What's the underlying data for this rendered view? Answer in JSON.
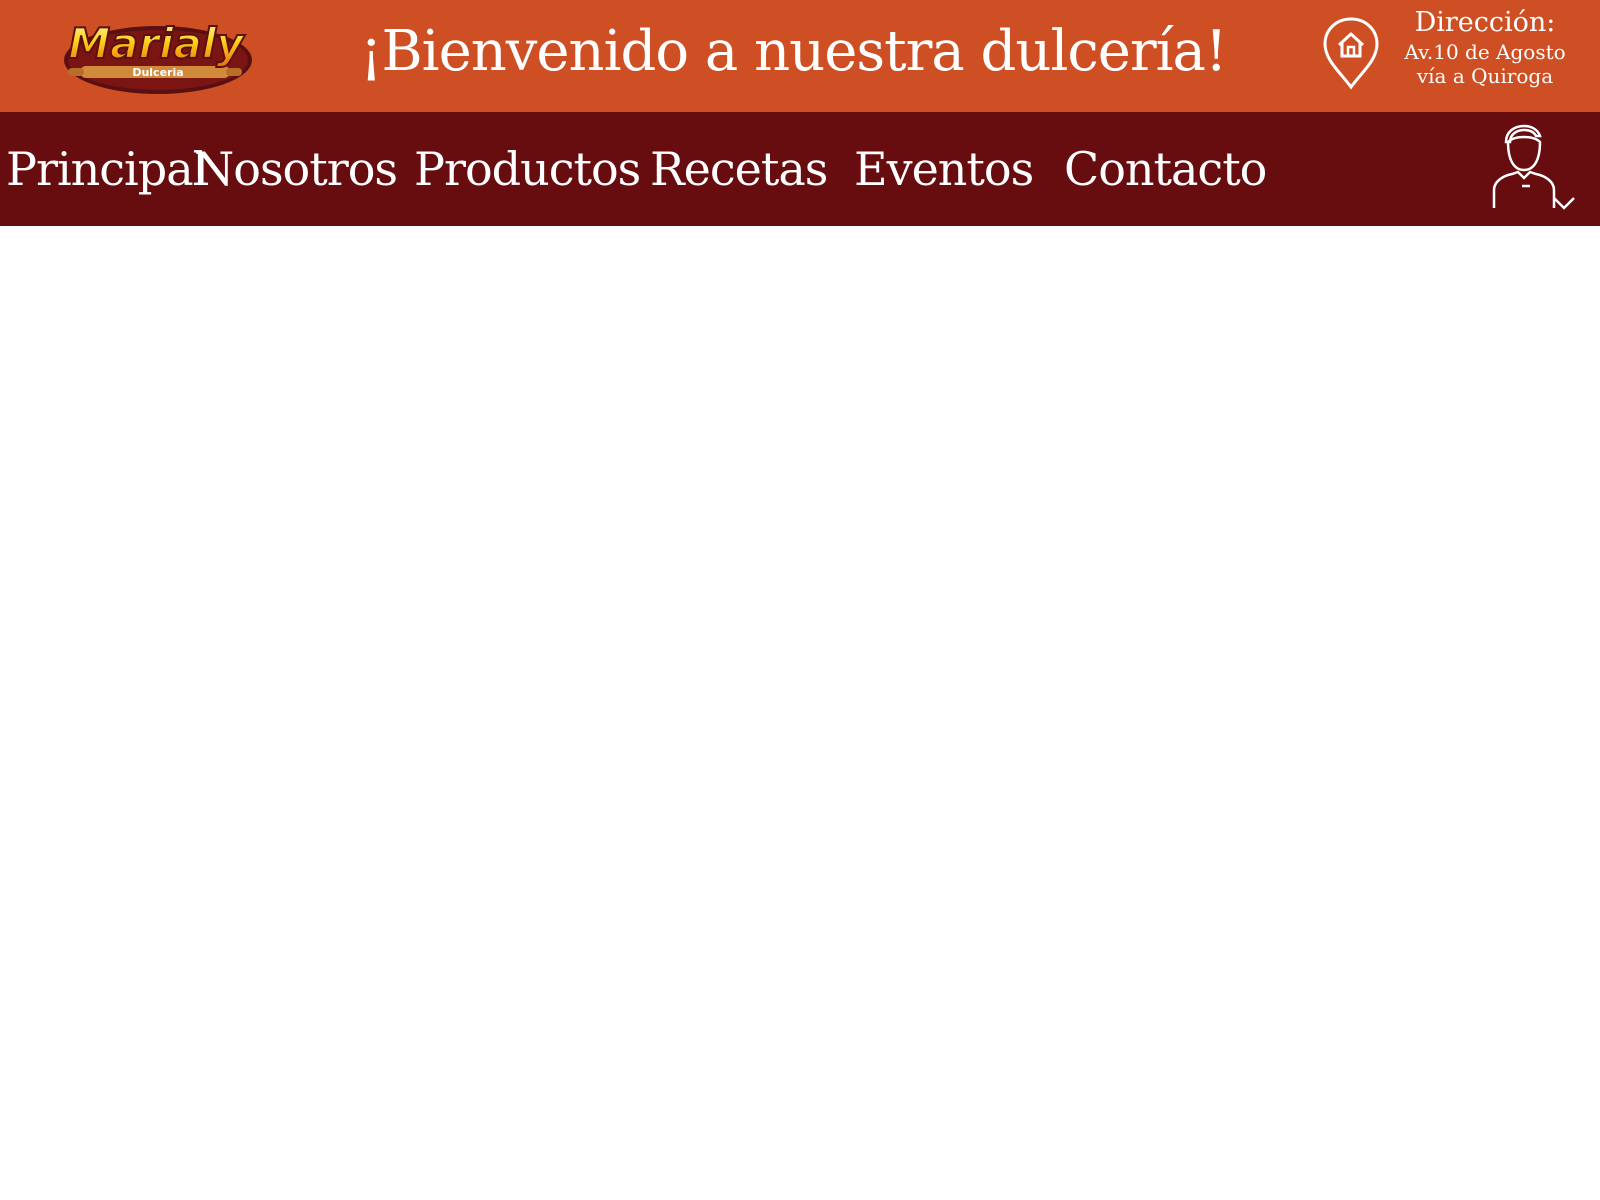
{
  "header": {
    "logo": {
      "brand_name": "Marialy",
      "tagline": "Dulceria"
    },
    "welcome_title": "¡Bienvenido a nuestra dulcería!",
    "address": {
      "title": "Dirección:",
      "line1": "Av.10 de Agosto",
      "line2": "vía a Quiroga",
      "icon": "home-location-pin-icon"
    }
  },
  "nav": {
    "items": [
      {
        "label": "Principal"
      },
      {
        "label": "Nosotros"
      },
      {
        "label": "Productos"
      },
      {
        "label": "Recetas"
      },
      {
        "label": "Eventos"
      },
      {
        "label": "Contacto"
      }
    ],
    "user_menu": {
      "icon": "user-avatar-icon",
      "dropdown_icon": "chevron-down-icon"
    }
  },
  "colors": {
    "header_bg": "#cf4f24",
    "nav_bg": "#670c0f",
    "text": "#ffffff",
    "content_bg": "#ffffff"
  }
}
